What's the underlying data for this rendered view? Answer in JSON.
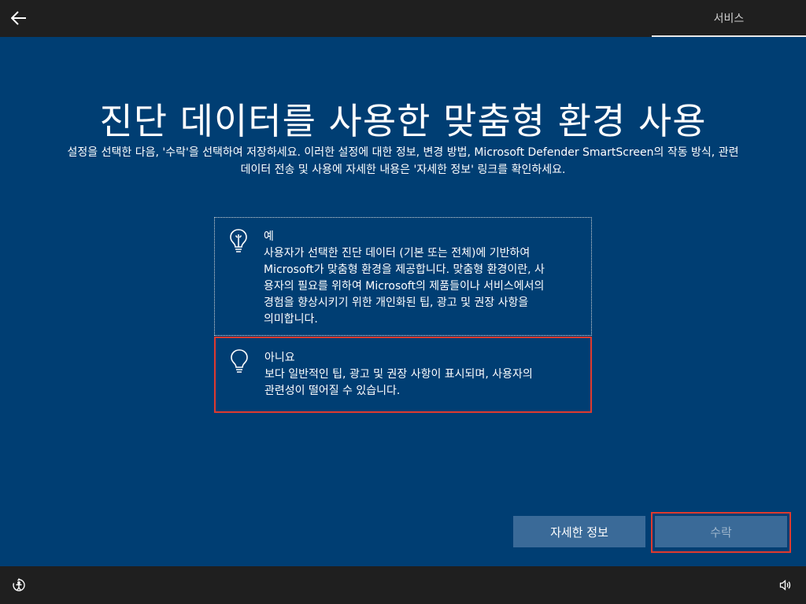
{
  "header": {
    "back_icon": "back-arrow-icon",
    "tab_label": "서비스"
  },
  "page": {
    "title": "진단 데이터를 사용한 맞춤형 환경 사용",
    "subtitle_line1": "설정을 선택한 다음, '수락'을 선택하여 저장하세요. 이러한 설정에 대한 정보, 변경 방법, Microsoft Defender SmartScreen의 작동 방식, 관련",
    "subtitle_line2": "데이터 전송 및 사용에 자세한 내용은 '자세한 정보' 링크를 확인하세요."
  },
  "options": [
    {
      "icon": "lightbulb-on-icon",
      "label": "예",
      "lines": [
        "사용자가 선택한 진단 데이터 (기본 또는 전체)에 기반하여",
        "Microsoft가 맞춤형 환경을 제공합니다. 맞춤형 환경이란, 사",
        "용자의 필요를 위하여 Microsoft의 제품들이나 서비스에서의",
        "경험을 향상시키기 위한 개인화된 팁, 광고 및 권장 사항을",
        "의미합니다."
      ]
    },
    {
      "icon": "lightbulb-off-icon",
      "label": "아니요",
      "lines": [
        "보다 일반적인 팁, 광고 및 권장 사항이 표시되며, 사용자의",
        "관련성이 떨어질 수 있습니다."
      ]
    }
  ],
  "buttons": {
    "learn_more": "자세한 정보",
    "accept": "수락"
  },
  "footer": {
    "left_icon": "ease-of-access-icon",
    "right_icon": "volume-icon"
  },
  "colors": {
    "background": "#003e73",
    "bar": "#1f1f1f",
    "button": "#3a6a98",
    "highlight": "#e03a2e"
  }
}
